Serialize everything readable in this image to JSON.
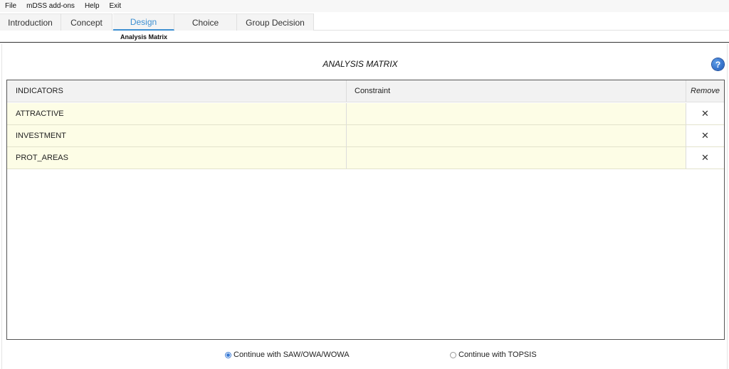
{
  "menu": [
    "File",
    "mDSS add-ons",
    "Help",
    "Exit"
  ],
  "tabs": [
    {
      "label": "Introduction"
    },
    {
      "label": "Concept"
    },
    {
      "label": "Design"
    },
    {
      "label": "Choice"
    },
    {
      "label": "Group Decision"
    }
  ],
  "active_tab": "Design",
  "subtab": "Analysis Matrix",
  "matrix": {
    "title": "ANALYSIS MATRIX",
    "help_icon": "question-circle-icon",
    "columns": [
      "INDICATORS",
      "Constraint",
      "Remove"
    ],
    "rows": [
      {
        "indicator": "ATTRACTIVE",
        "constraint": "",
        "remove": "✕"
      },
      {
        "indicator": "INVESTMENT",
        "constraint": "",
        "remove": "✕"
      },
      {
        "indicator": "PROT_AREAS",
        "constraint": "",
        "remove": "✕"
      }
    ]
  },
  "options": [
    {
      "label": "Continue with SAW/OWA/WOWA",
      "selected": true
    },
    {
      "label": "Continue with TOPSIS",
      "selected": false
    }
  ],
  "colors": {
    "accent": "#3d8fd1",
    "row_highlight": "#fdfde6"
  }
}
